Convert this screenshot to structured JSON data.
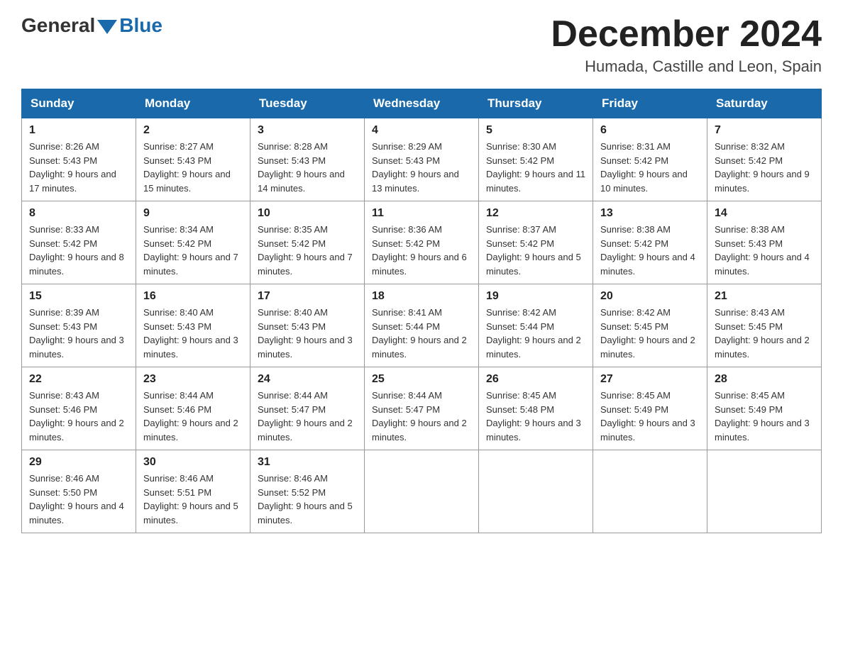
{
  "logo": {
    "general": "General",
    "blue": "Blue"
  },
  "title": {
    "month_year": "December 2024",
    "location": "Humada, Castille and Leon, Spain"
  },
  "weekdays": [
    "Sunday",
    "Monday",
    "Tuesday",
    "Wednesday",
    "Thursday",
    "Friday",
    "Saturday"
  ],
  "weeks": [
    [
      {
        "day": "1",
        "sunrise": "8:26 AM",
        "sunset": "5:43 PM",
        "daylight": "9 hours and 17 minutes."
      },
      {
        "day": "2",
        "sunrise": "8:27 AM",
        "sunset": "5:43 PM",
        "daylight": "9 hours and 15 minutes."
      },
      {
        "day": "3",
        "sunrise": "8:28 AM",
        "sunset": "5:43 PM",
        "daylight": "9 hours and 14 minutes."
      },
      {
        "day": "4",
        "sunrise": "8:29 AM",
        "sunset": "5:43 PM",
        "daylight": "9 hours and 13 minutes."
      },
      {
        "day": "5",
        "sunrise": "8:30 AM",
        "sunset": "5:42 PM",
        "daylight": "9 hours and 11 minutes."
      },
      {
        "day": "6",
        "sunrise": "8:31 AM",
        "sunset": "5:42 PM",
        "daylight": "9 hours and 10 minutes."
      },
      {
        "day": "7",
        "sunrise": "8:32 AM",
        "sunset": "5:42 PM",
        "daylight": "9 hours and 9 minutes."
      }
    ],
    [
      {
        "day": "8",
        "sunrise": "8:33 AM",
        "sunset": "5:42 PM",
        "daylight": "9 hours and 8 minutes."
      },
      {
        "day": "9",
        "sunrise": "8:34 AM",
        "sunset": "5:42 PM",
        "daylight": "9 hours and 7 minutes."
      },
      {
        "day": "10",
        "sunrise": "8:35 AM",
        "sunset": "5:42 PM",
        "daylight": "9 hours and 7 minutes."
      },
      {
        "day": "11",
        "sunrise": "8:36 AM",
        "sunset": "5:42 PM",
        "daylight": "9 hours and 6 minutes."
      },
      {
        "day": "12",
        "sunrise": "8:37 AM",
        "sunset": "5:42 PM",
        "daylight": "9 hours and 5 minutes."
      },
      {
        "day": "13",
        "sunrise": "8:38 AM",
        "sunset": "5:42 PM",
        "daylight": "9 hours and 4 minutes."
      },
      {
        "day": "14",
        "sunrise": "8:38 AM",
        "sunset": "5:43 PM",
        "daylight": "9 hours and 4 minutes."
      }
    ],
    [
      {
        "day": "15",
        "sunrise": "8:39 AM",
        "sunset": "5:43 PM",
        "daylight": "9 hours and 3 minutes."
      },
      {
        "day": "16",
        "sunrise": "8:40 AM",
        "sunset": "5:43 PM",
        "daylight": "9 hours and 3 minutes."
      },
      {
        "day": "17",
        "sunrise": "8:40 AM",
        "sunset": "5:43 PM",
        "daylight": "9 hours and 3 minutes."
      },
      {
        "day": "18",
        "sunrise": "8:41 AM",
        "sunset": "5:44 PM",
        "daylight": "9 hours and 2 minutes."
      },
      {
        "day": "19",
        "sunrise": "8:42 AM",
        "sunset": "5:44 PM",
        "daylight": "9 hours and 2 minutes."
      },
      {
        "day": "20",
        "sunrise": "8:42 AM",
        "sunset": "5:45 PM",
        "daylight": "9 hours and 2 minutes."
      },
      {
        "day": "21",
        "sunrise": "8:43 AM",
        "sunset": "5:45 PM",
        "daylight": "9 hours and 2 minutes."
      }
    ],
    [
      {
        "day": "22",
        "sunrise": "8:43 AM",
        "sunset": "5:46 PM",
        "daylight": "9 hours and 2 minutes."
      },
      {
        "day": "23",
        "sunrise": "8:44 AM",
        "sunset": "5:46 PM",
        "daylight": "9 hours and 2 minutes."
      },
      {
        "day": "24",
        "sunrise": "8:44 AM",
        "sunset": "5:47 PM",
        "daylight": "9 hours and 2 minutes."
      },
      {
        "day": "25",
        "sunrise": "8:44 AM",
        "sunset": "5:47 PM",
        "daylight": "9 hours and 2 minutes."
      },
      {
        "day": "26",
        "sunrise": "8:45 AM",
        "sunset": "5:48 PM",
        "daylight": "9 hours and 3 minutes."
      },
      {
        "day": "27",
        "sunrise": "8:45 AM",
        "sunset": "5:49 PM",
        "daylight": "9 hours and 3 minutes."
      },
      {
        "day": "28",
        "sunrise": "8:45 AM",
        "sunset": "5:49 PM",
        "daylight": "9 hours and 3 minutes."
      }
    ],
    [
      {
        "day": "29",
        "sunrise": "8:46 AM",
        "sunset": "5:50 PM",
        "daylight": "9 hours and 4 minutes."
      },
      {
        "day": "30",
        "sunrise": "8:46 AM",
        "sunset": "5:51 PM",
        "daylight": "9 hours and 5 minutes."
      },
      {
        "day": "31",
        "sunrise": "8:46 AM",
        "sunset": "5:52 PM",
        "daylight": "9 hours and 5 minutes."
      },
      null,
      null,
      null,
      null
    ]
  ]
}
